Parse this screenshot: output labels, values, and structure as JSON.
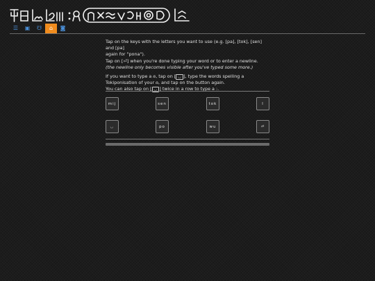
{
  "tabs": [
    {
      "label": "☰"
    },
    {
      "label": "▣"
    },
    {
      "label": "☋"
    },
    {
      "label": "⌂"
    },
    {
      "label": "◙"
    }
  ],
  "instructions": {
    "line1": "Tap on the keys with the letters you want to use (e.g. [pa], [tok], [sen] and [pa]",
    "line2": "again for \"pona\").",
    "line3a": "Tap on [",
    "newline_glyph": "⏎",
    "line3b": "] when you're done typing your word or to enter a newline.",
    "line4": "(the newline only becomes visible after you've typed some more.)",
    "line5a": "If you want to type a ",
    "cartouche_glyph": "⍝",
    "line5b": ", tap on [",
    "cartouche_key_glyph": "◡",
    "line5c": "], type the words spelling a",
    "line6a": "Tokiponisation of your ",
    "line6b": ", and tap on the button again.",
    "line7a": "You can also tap on [",
    "line7b": "] twice in a row to type a ",
    "colon_glyph": ":",
    "line7c": "."
  },
  "keyboard": {
    "row1": [
      "mij",
      "sen",
      "tok",
      "l"
    ],
    "row2": [
      "◡",
      "po",
      "wu",
      "⏎"
    ]
  }
}
